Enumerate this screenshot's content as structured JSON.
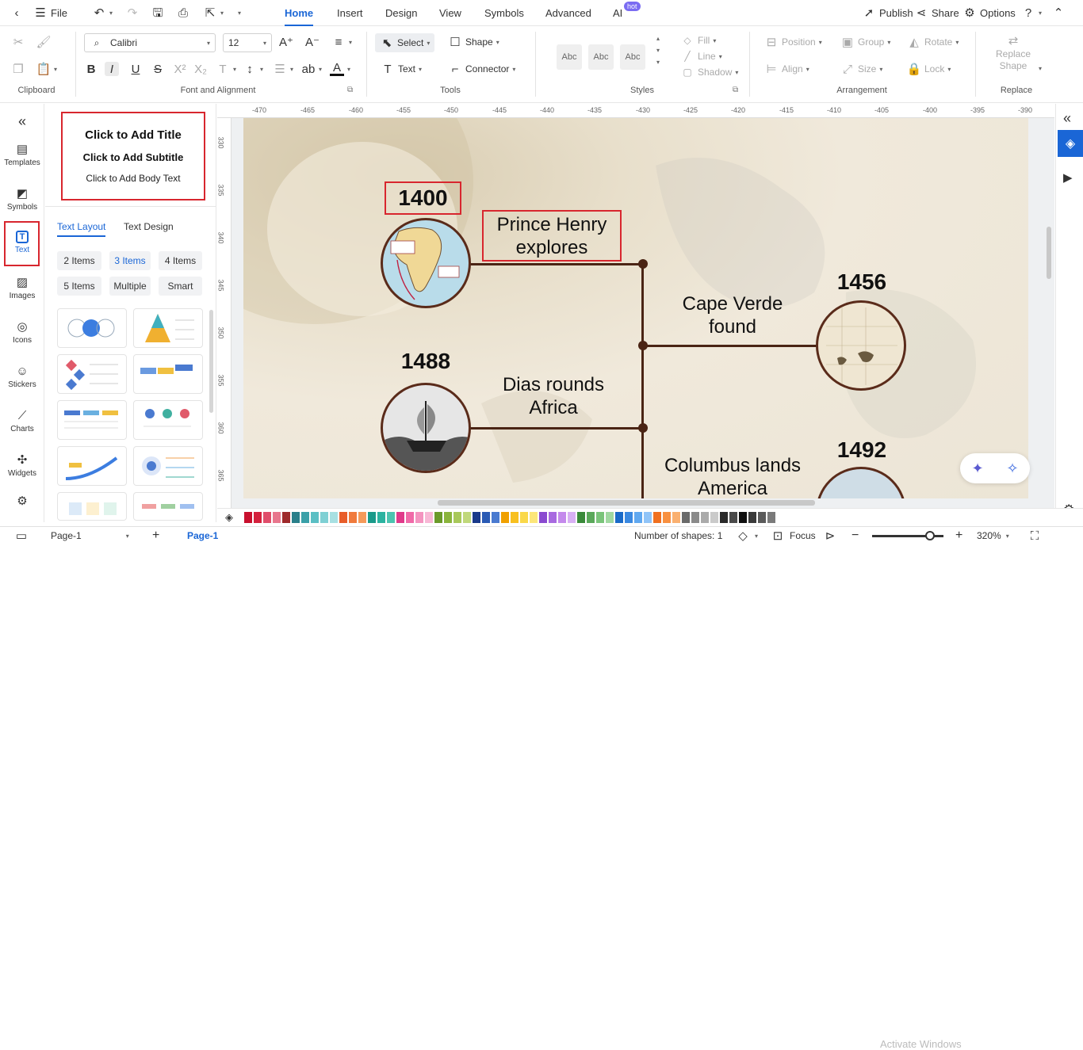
{
  "menubar": {
    "file": "File",
    "tabs": [
      "Home",
      "Insert",
      "Design",
      "View",
      "Symbols",
      "Advanced",
      "AI"
    ],
    "hot_badge": "hot",
    "publish": "Publish",
    "share": "Share",
    "options": "Options"
  },
  "ribbon": {
    "clipboard_label": "Clipboard",
    "font_name": "Calibri",
    "font_size": "12",
    "font_group_label": "Font and Alignment",
    "select": "Select",
    "shape": "Shape",
    "text": "Text",
    "connector": "Connector",
    "tools_label": "Tools",
    "style_sample": "Abc",
    "styles_label": "Styles",
    "fill": "Fill",
    "line": "Line",
    "shadow": "Shadow",
    "position": "Position",
    "group": "Group",
    "rotate": "Rotate",
    "align": "Align",
    "size": "Size",
    "lock": "Lock",
    "arrangement_label": "Arrangement",
    "replace_shape_line1": "Replace",
    "replace_shape_line2": "Shape",
    "replace_label": "Replace"
  },
  "leftrail": {
    "items": [
      "Templates",
      "Symbols",
      "Text",
      "Images",
      "Icons",
      "Stickers",
      "Charts",
      "Widgets"
    ]
  },
  "panel": {
    "add_title": "Click to Add Title",
    "add_subtitle": "Click to Add Subtitle",
    "add_body": "Click to Add Body Text",
    "tab_layout": "Text Layout",
    "tab_design": "Text Design",
    "chips": [
      "2 Items",
      "3 Items",
      "4 Items",
      "5 Items",
      "Multiple",
      "Smart"
    ]
  },
  "rulers": {
    "top": [
      "-470",
      "-465",
      "-460",
      "-455",
      "-450",
      "-445",
      "-440",
      "-435",
      "-430",
      "-425",
      "-420",
      "-415",
      "-410",
      "-405",
      "-400",
      "-395",
      "-390"
    ],
    "left": [
      "330",
      "335",
      "340",
      "345",
      "350",
      "355",
      "360",
      "365"
    ]
  },
  "timeline": {
    "y1400": "1400",
    "e1400_l1": "Prince Henry",
    "e1400_l2": "explores",
    "y1456": "1456",
    "e1456_l1": "Cape Verde",
    "e1456_l2": "found",
    "y1488": "1488",
    "e1488_l1": "Dias rounds",
    "e1488_l2": "Africa",
    "y1492": "1492",
    "e1492_l1": "Columbus lands",
    "e1492_l2": "America"
  },
  "palette": {
    "colors": [
      "#c8102e",
      "#d4213d",
      "#e04d6a",
      "#e8768d",
      "#9e2a2b",
      "#2a7f8a",
      "#3aa0a8",
      "#5bbfc4",
      "#7fd0d4",
      "#a8e0e2",
      "#e85d2a",
      "#f07a3c",
      "#f59a5a",
      "#1a9a8a",
      "#2cb3a0",
      "#4cc4b0",
      "#e03a8a",
      "#f06aa8",
      "#f494c0",
      "#f8b8d6",
      "#6a9a2a",
      "#8ab43c",
      "#a8c85a",
      "#c0d87a",
      "#1a3a8a",
      "#2a5ab4",
      "#4a7ad0",
      "#f0a000",
      "#f8c020",
      "#fad84a",
      "#fce67a",
      "#8a4ad0",
      "#a86ae0",
      "#c48aec",
      "#d8b0f4",
      "#3a8a3a",
      "#5aa85a",
      "#7ac47a",
      "#a0d8a0",
      "#1a6ac8",
      "#3a88e0",
      "#60a8f0",
      "#90c4f8",
      "#f07020",
      "#f89040",
      "#fab070",
      "#6a6a6a",
      "#8a8a8a",
      "#aaaaaa",
      "#cacaca",
      "#2a2a2a",
      "#4a4a4a",
      "#101010",
      "#3a3a3a",
      "#5a5a5a",
      "#7a7a7a"
    ]
  },
  "status": {
    "page_select": "Page-1",
    "page_tab": "Page-1",
    "shape_count": "Number of shapes: 1",
    "focus": "Focus",
    "zoom": "320%",
    "watermark": "Activate Windows"
  }
}
